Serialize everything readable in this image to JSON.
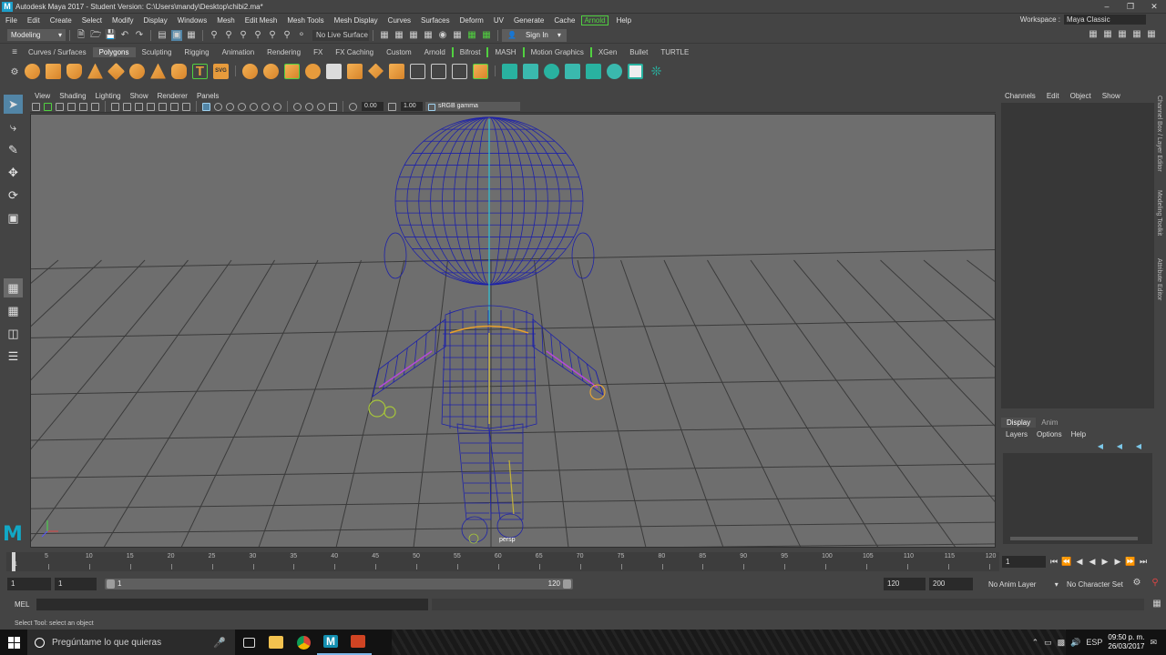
{
  "window": {
    "title": "Autodesk Maya 2017 - Student Version: C:\\Users\\mandy\\Desktop\\chibi2.ma*",
    "logo": "M",
    "controls": [
      "minimize-icon",
      "restore-icon",
      "close-icon"
    ]
  },
  "menu": {
    "items": [
      "File",
      "Edit",
      "Create",
      "Select",
      "Modify",
      "Display",
      "Windows",
      "Mesh",
      "Edit Mesh",
      "Mesh Tools",
      "Mesh Display",
      "Curves",
      "Surfaces",
      "Deform",
      "UV",
      "Generate",
      "Cache",
      "Arnold",
      "Help"
    ],
    "workspace_label": "Workspace :",
    "workspace_value": "Maya Classic"
  },
  "statusline": {
    "mode": "Modeling",
    "live_surface": "No Live Surface",
    "sign_in": "Sign In"
  },
  "shelf": {
    "tabs": [
      "Curves / Surfaces",
      "Polygons",
      "Sculpting",
      "Rigging",
      "Animation",
      "Rendering",
      "FX",
      "FX Caching",
      "Custom",
      "Arnold",
      "Bifrost",
      "MASH",
      "Motion Graphics",
      "XGen",
      "Bullet",
      "TURTLE"
    ],
    "active_tab": "Polygons",
    "svg_icon_text": "SVG",
    "text_icon": "T"
  },
  "viewport": {
    "menu": [
      "View",
      "Shading",
      "Lighting",
      "Show",
      "Renderer",
      "Panels"
    ],
    "exposure": "0.00",
    "gamma": "1.00",
    "color_space": "sRGB gamma",
    "camera_label": "persp"
  },
  "channelbox": {
    "menu": [
      "Channels",
      "Edit",
      "Object",
      "Show"
    ],
    "vertical_tabs": [
      "Channel Box / Layer Editor",
      "Modeling Toolkit",
      "Attribute Editor"
    ]
  },
  "layers": {
    "tabs": [
      "Display",
      "Anim"
    ],
    "active_tab": "Display",
    "menu": [
      "Layers",
      "Options",
      "Help"
    ]
  },
  "timeslider": {
    "ticks": [
      "5",
      "10",
      "15",
      "20",
      "25",
      "30",
      "35",
      "40",
      "45",
      "50",
      "55",
      "60",
      "65",
      "70",
      "75",
      "80",
      "85",
      "90",
      "95",
      "100",
      "105",
      "110",
      "115",
      "120"
    ],
    "current_frame": "1",
    "start_tick": "1",
    "frame_field": "1"
  },
  "range": {
    "start_field": "1",
    "inner_start_field": "1",
    "bar_start": "1",
    "bar_end": "120",
    "end_field": "120",
    "max_field": "200",
    "anim_layer": "No Anim Layer",
    "character_set": "No Character Set"
  },
  "command": {
    "label": "MEL",
    "help": "Select Tool: select an object"
  },
  "taskbar": {
    "search_placeholder": "Pregúntame lo que quieras",
    "language": "ESP",
    "time": "09:50 p. m.",
    "date": "26/03/2017"
  }
}
